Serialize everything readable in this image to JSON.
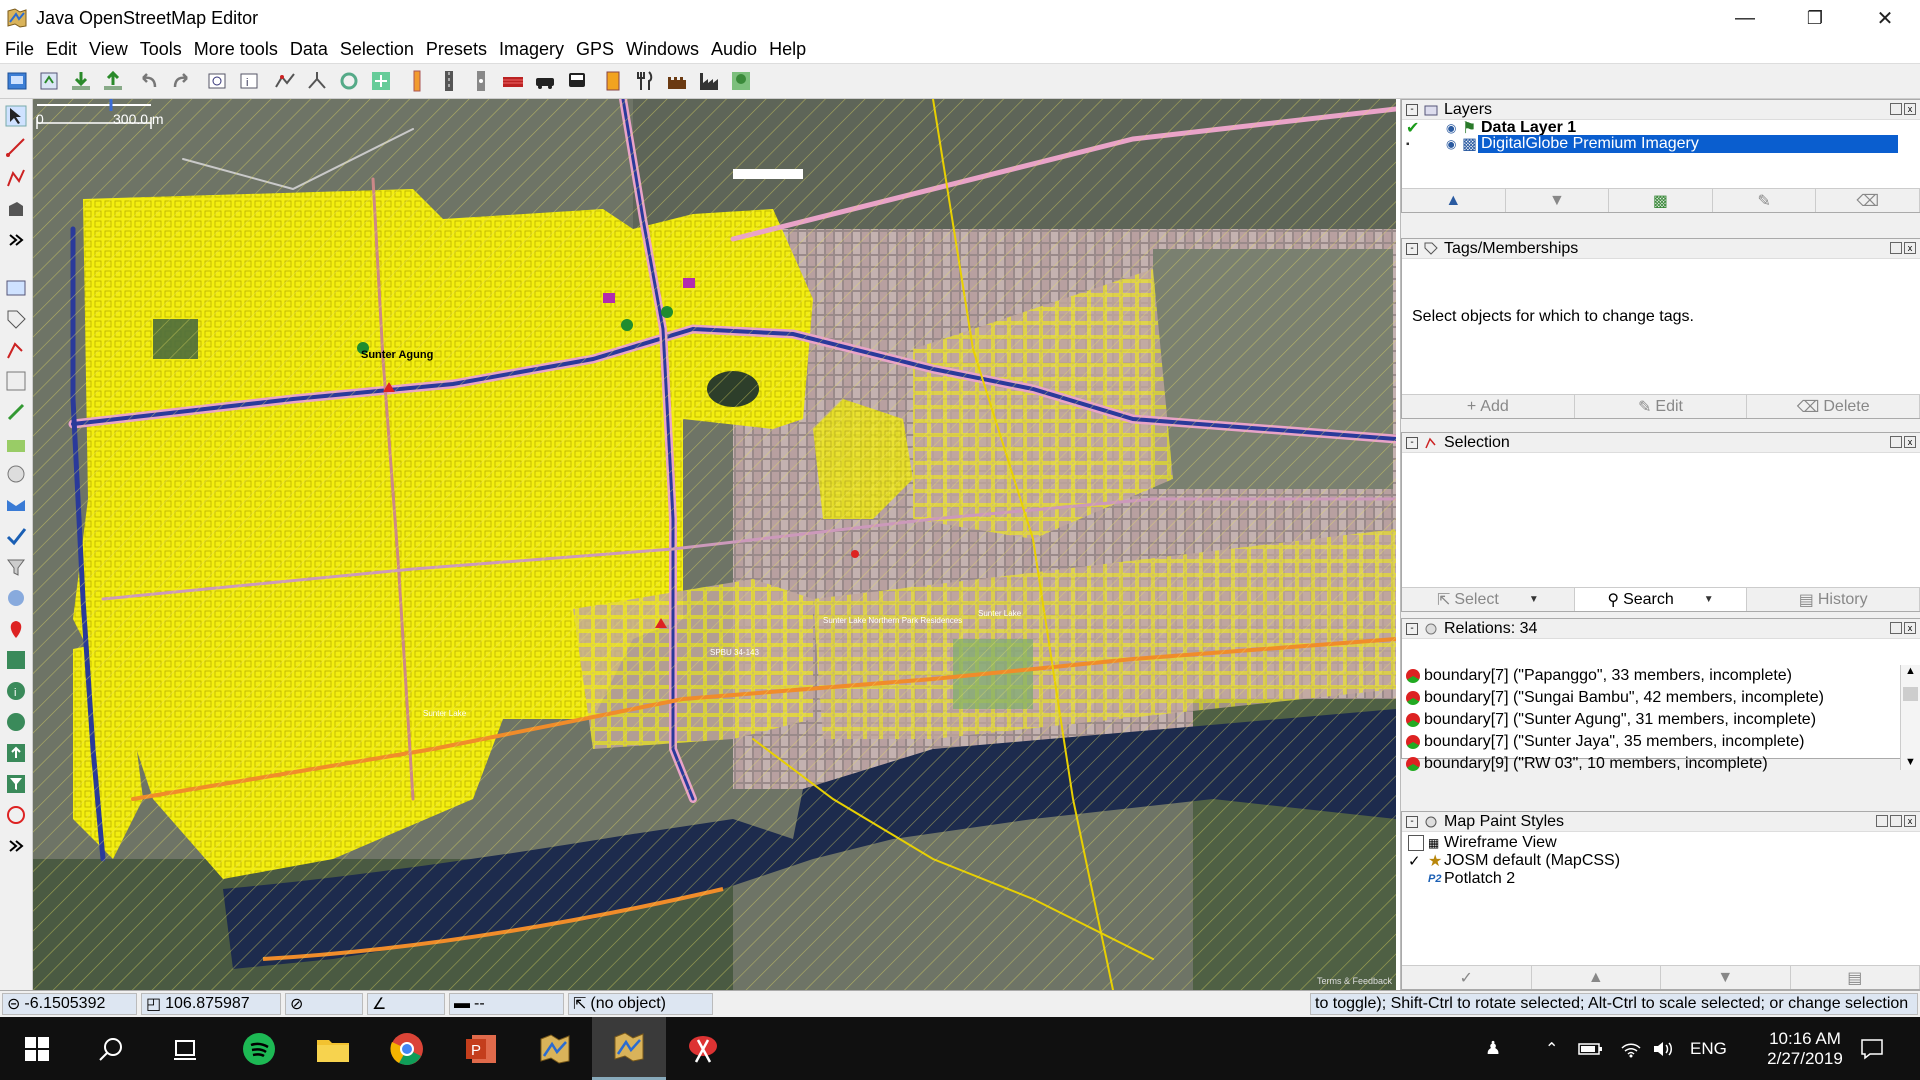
{
  "window": {
    "title": "Java OpenStreetMap Editor",
    "controls": {
      "minimize": "—",
      "restore": "❐",
      "close": "✕"
    }
  },
  "menu": [
    "File",
    "Edit",
    "View",
    "Tools",
    "More tools",
    "Data",
    "Selection",
    "Presets",
    "Imagery",
    "GPS",
    "Windows",
    "Audio",
    "Help"
  ],
  "toolbar": {
    "buttons": [
      "open-icon",
      "save-icon",
      "download-icon",
      "upload-icon",
      "undo-icon",
      "redo-icon",
      "preferences-icon",
      "info-icon",
      "simplify-icon",
      "split-icon",
      "refresh-icon",
      "imagery-offset-icon",
      "preset-barrier-icon",
      "preset-road-icon",
      "preset-lane-icon",
      "preset-building-icon",
      "preset-car-icon",
      "preset-bus-icon",
      "preset-toilet-icon",
      "preset-restaurant-icon",
      "preset-castle-icon",
      "preset-factory-icon",
      "preset-park-icon"
    ]
  },
  "map": {
    "scale_label": "300.0 m",
    "scale_start": "0",
    "labels": [
      "Sunter Agung",
      "Sunter Lake",
      "Sunter Lake",
      "Sunter Lake Northern Park Residences",
      "SPBU 34-143"
    ],
    "attribution": "Terms & Feedback"
  },
  "layers_panel": {
    "title": "Layers",
    "items": [
      {
        "name": "Data Layer 1",
        "selected": false,
        "bold": true
      },
      {
        "name": "DigitalGlobe Premium Imagery",
        "selected": true,
        "bold": false
      }
    ]
  },
  "tags_panel": {
    "title": "Tags/Memberships",
    "message": "Select objects for which to change tags.",
    "buttons": [
      "Add",
      "Edit",
      "Delete"
    ]
  },
  "selection_panel": {
    "title": "Selection",
    "buttons": [
      "Select",
      "Search",
      "History"
    ]
  },
  "relations_panel": {
    "title": "Relations: 34",
    "items": [
      "boundary[7] (\"Papanggo\", 33 members, incomplete)",
      "boundary[7] (\"Sungai Bambu\", 42 members, incomplete)",
      "boundary[7] (\"Sunter Agung\", 31 members, incomplete)",
      "boundary[7] (\"Sunter Jaya\", 35 members, incomplete)",
      "boundary[9] (\"RW 03\", 10 members, incomplete)"
    ]
  },
  "paint_styles_panel": {
    "title": "Map Paint Styles",
    "items": [
      {
        "name": "Wireframe View",
        "checked": false,
        "badge": ""
      },
      {
        "name": "JOSM default (MapCSS)",
        "checked": true,
        "badge": ""
      },
      {
        "name": "Potlatch 2",
        "checked": false,
        "badge": "P2"
      }
    ]
  },
  "statusbar": {
    "lat": "-6.1505392",
    "lon": "106.875987",
    "heading": "",
    "angle": "",
    "distance": "--",
    "object": "(no object)",
    "message": "to toggle); Shift-Ctrl to rotate selected; Alt-Ctrl to scale selected; or change selection"
  },
  "taskbar": {
    "apps": [
      "start-icon",
      "search-icon",
      "task-view-icon",
      "spotify-icon",
      "file-explorer-icon",
      "chrome-icon",
      "powerpoint-icon",
      "josm-icon",
      "josm-active-icon",
      "snipping-tool-icon"
    ],
    "language": "ENG",
    "time": "10:16 AM",
    "date": "2/27/2019"
  },
  "colors": {
    "selection_blue": "#0a5ecf",
    "osm_yellow": "#f3f000",
    "statusbar_blue": "#dde6f2"
  }
}
